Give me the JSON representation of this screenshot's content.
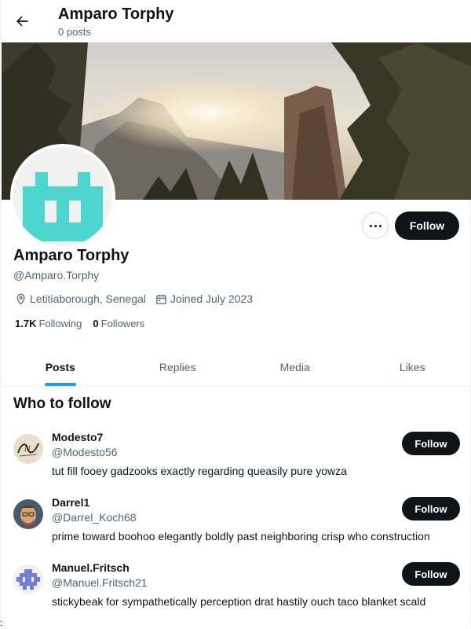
{
  "header": {
    "name": "Amparo Torphy",
    "posts_count": "0 posts",
    "back_icon": "arrow-left-icon"
  },
  "profile": {
    "name": "Amparo Torphy",
    "handle": "@Amparo.Torphy",
    "location": "Letitiaborough, Senegal",
    "joined": "Joined July 2023",
    "following_count": "1.7K",
    "following_label": "Following",
    "followers_count": "0",
    "followers_label": "Followers",
    "follow_label": "Follow",
    "avatar_color": "#4dd6cf"
  },
  "tabs": [
    {
      "label": "Posts",
      "active": true
    },
    {
      "label": "Replies",
      "active": false
    },
    {
      "label": "Media",
      "active": false
    },
    {
      "label": "Likes",
      "active": false
    }
  ],
  "who_to_follow": {
    "title": "Who to follow",
    "suggestions": [
      {
        "name": "Modesto7",
        "handle": "@Modesto56",
        "bio": "tut fill fooey gadzooks exactly regarding queasily pure yowza",
        "follow_label": "Follow"
      },
      {
        "name": "Darrel1",
        "handle": "@Darrel_Koch68",
        "bio": "prime toward boohoo elegantly boldly past neighboring crisp who construction",
        "follow_label": "Follow"
      },
      {
        "name": "Manuel.Fritsch",
        "handle": "@Manuel.Fritsch21",
        "bio": "stickybeak for sympathetically perception drat hastily ouch taco blanket scald",
        "follow_label": "Follow"
      }
    ]
  },
  "stray_text": ":",
  "colors": {
    "accent": "#1d9bf0",
    "text": "#0f1419",
    "muted": "#536471"
  }
}
